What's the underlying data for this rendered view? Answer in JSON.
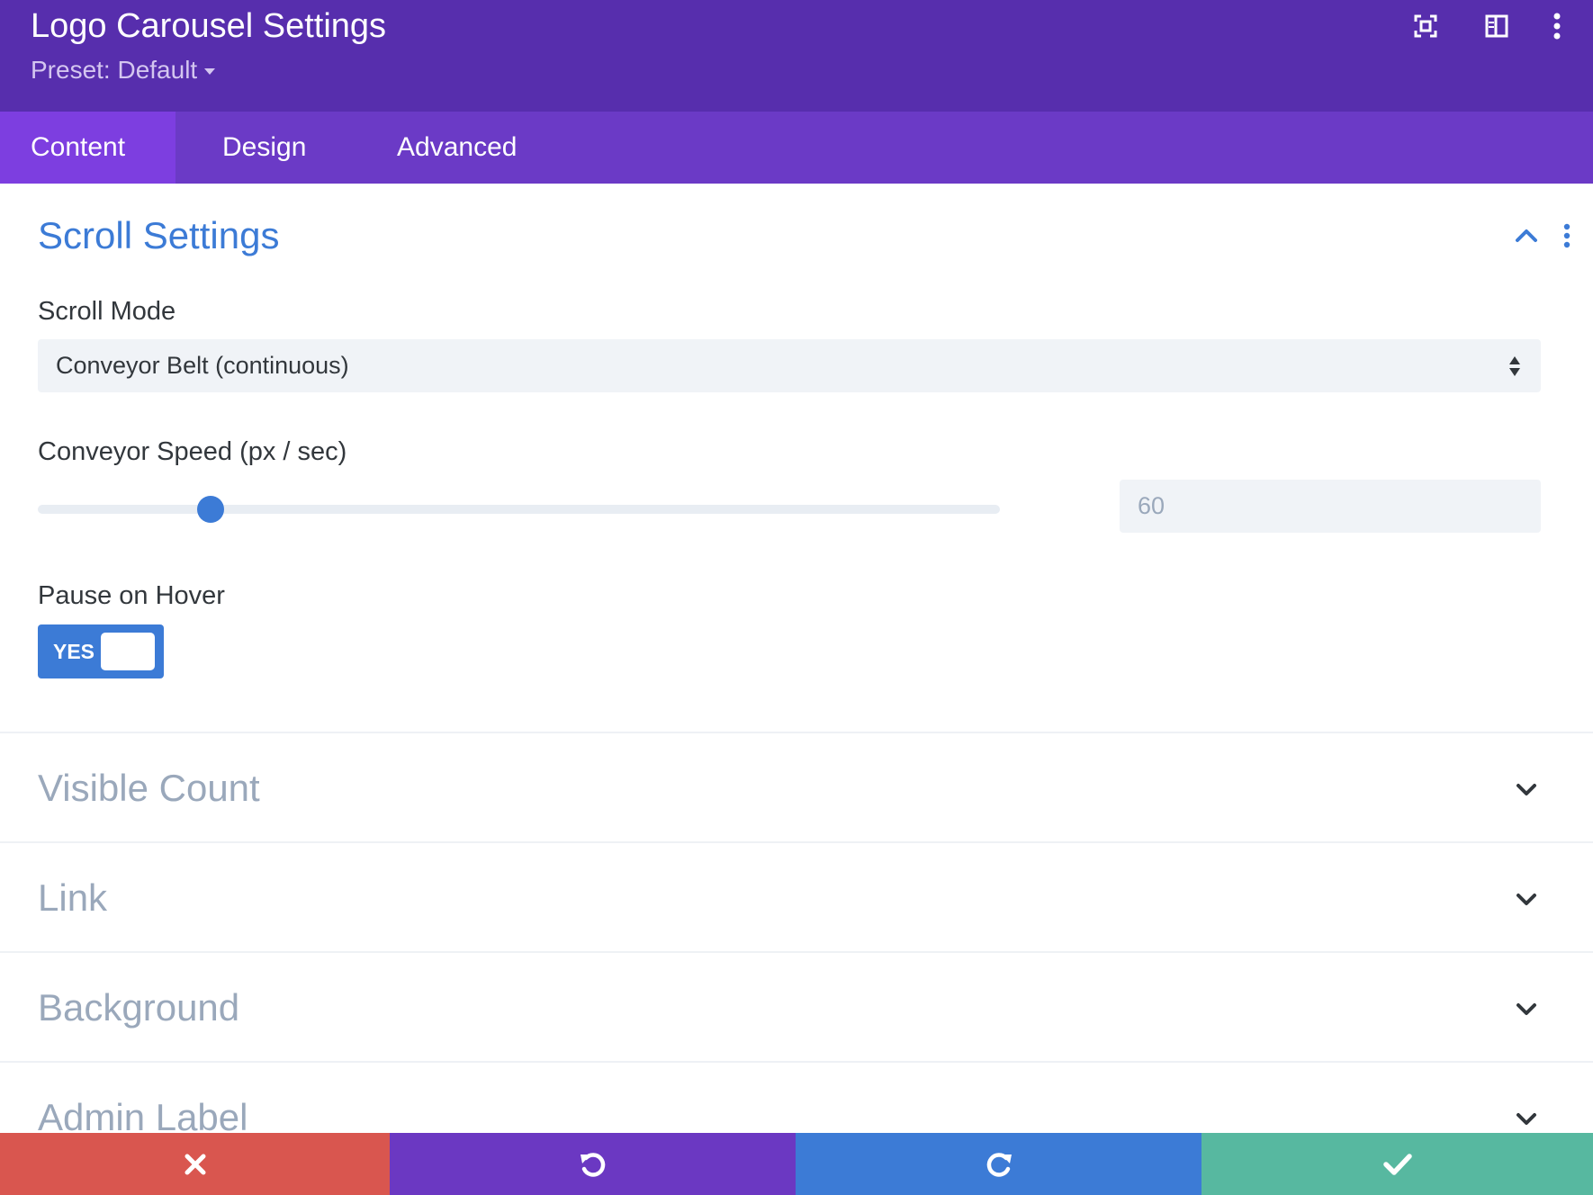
{
  "header": {
    "title": "Logo Carousel Settings",
    "preset_label": "Preset: Default",
    "icons": [
      "focus-icon",
      "split-view-icon",
      "more-vertical-icon"
    ]
  },
  "tabs": [
    {
      "label": "Content",
      "active": true
    },
    {
      "label": "Design",
      "active": false
    },
    {
      "label": "Advanced",
      "active": false
    }
  ],
  "scroll_settings": {
    "title": "Scroll Settings",
    "scroll_mode": {
      "label": "Scroll Mode",
      "value": "Conveyor Belt (continuous)"
    },
    "conveyor_speed": {
      "label": "Conveyor Speed (px / sec)",
      "value": "60",
      "slider_fraction": 0.18
    },
    "pause_on_hover": {
      "label": "Pause on Hover",
      "toggle_text": "YES",
      "on": true
    }
  },
  "sections": [
    {
      "title": "Visible Count"
    },
    {
      "title": "Link"
    },
    {
      "title": "Background"
    },
    {
      "title": "Admin Label"
    }
  ],
  "footer": {
    "buttons": [
      "close-icon",
      "undo-icon",
      "redo-icon",
      "check-icon"
    ]
  },
  "colors": {
    "header_bg": "#572ead",
    "tabs_bg": "#6b3ac6",
    "active_tab_bg": "#7d3ee0",
    "accent_blue": "#3c7bd6",
    "cancel_red": "#d9564f",
    "undo_purple": "#6b38c2",
    "redo_blue": "#3c7bd6",
    "save_green": "#57b8a0"
  }
}
